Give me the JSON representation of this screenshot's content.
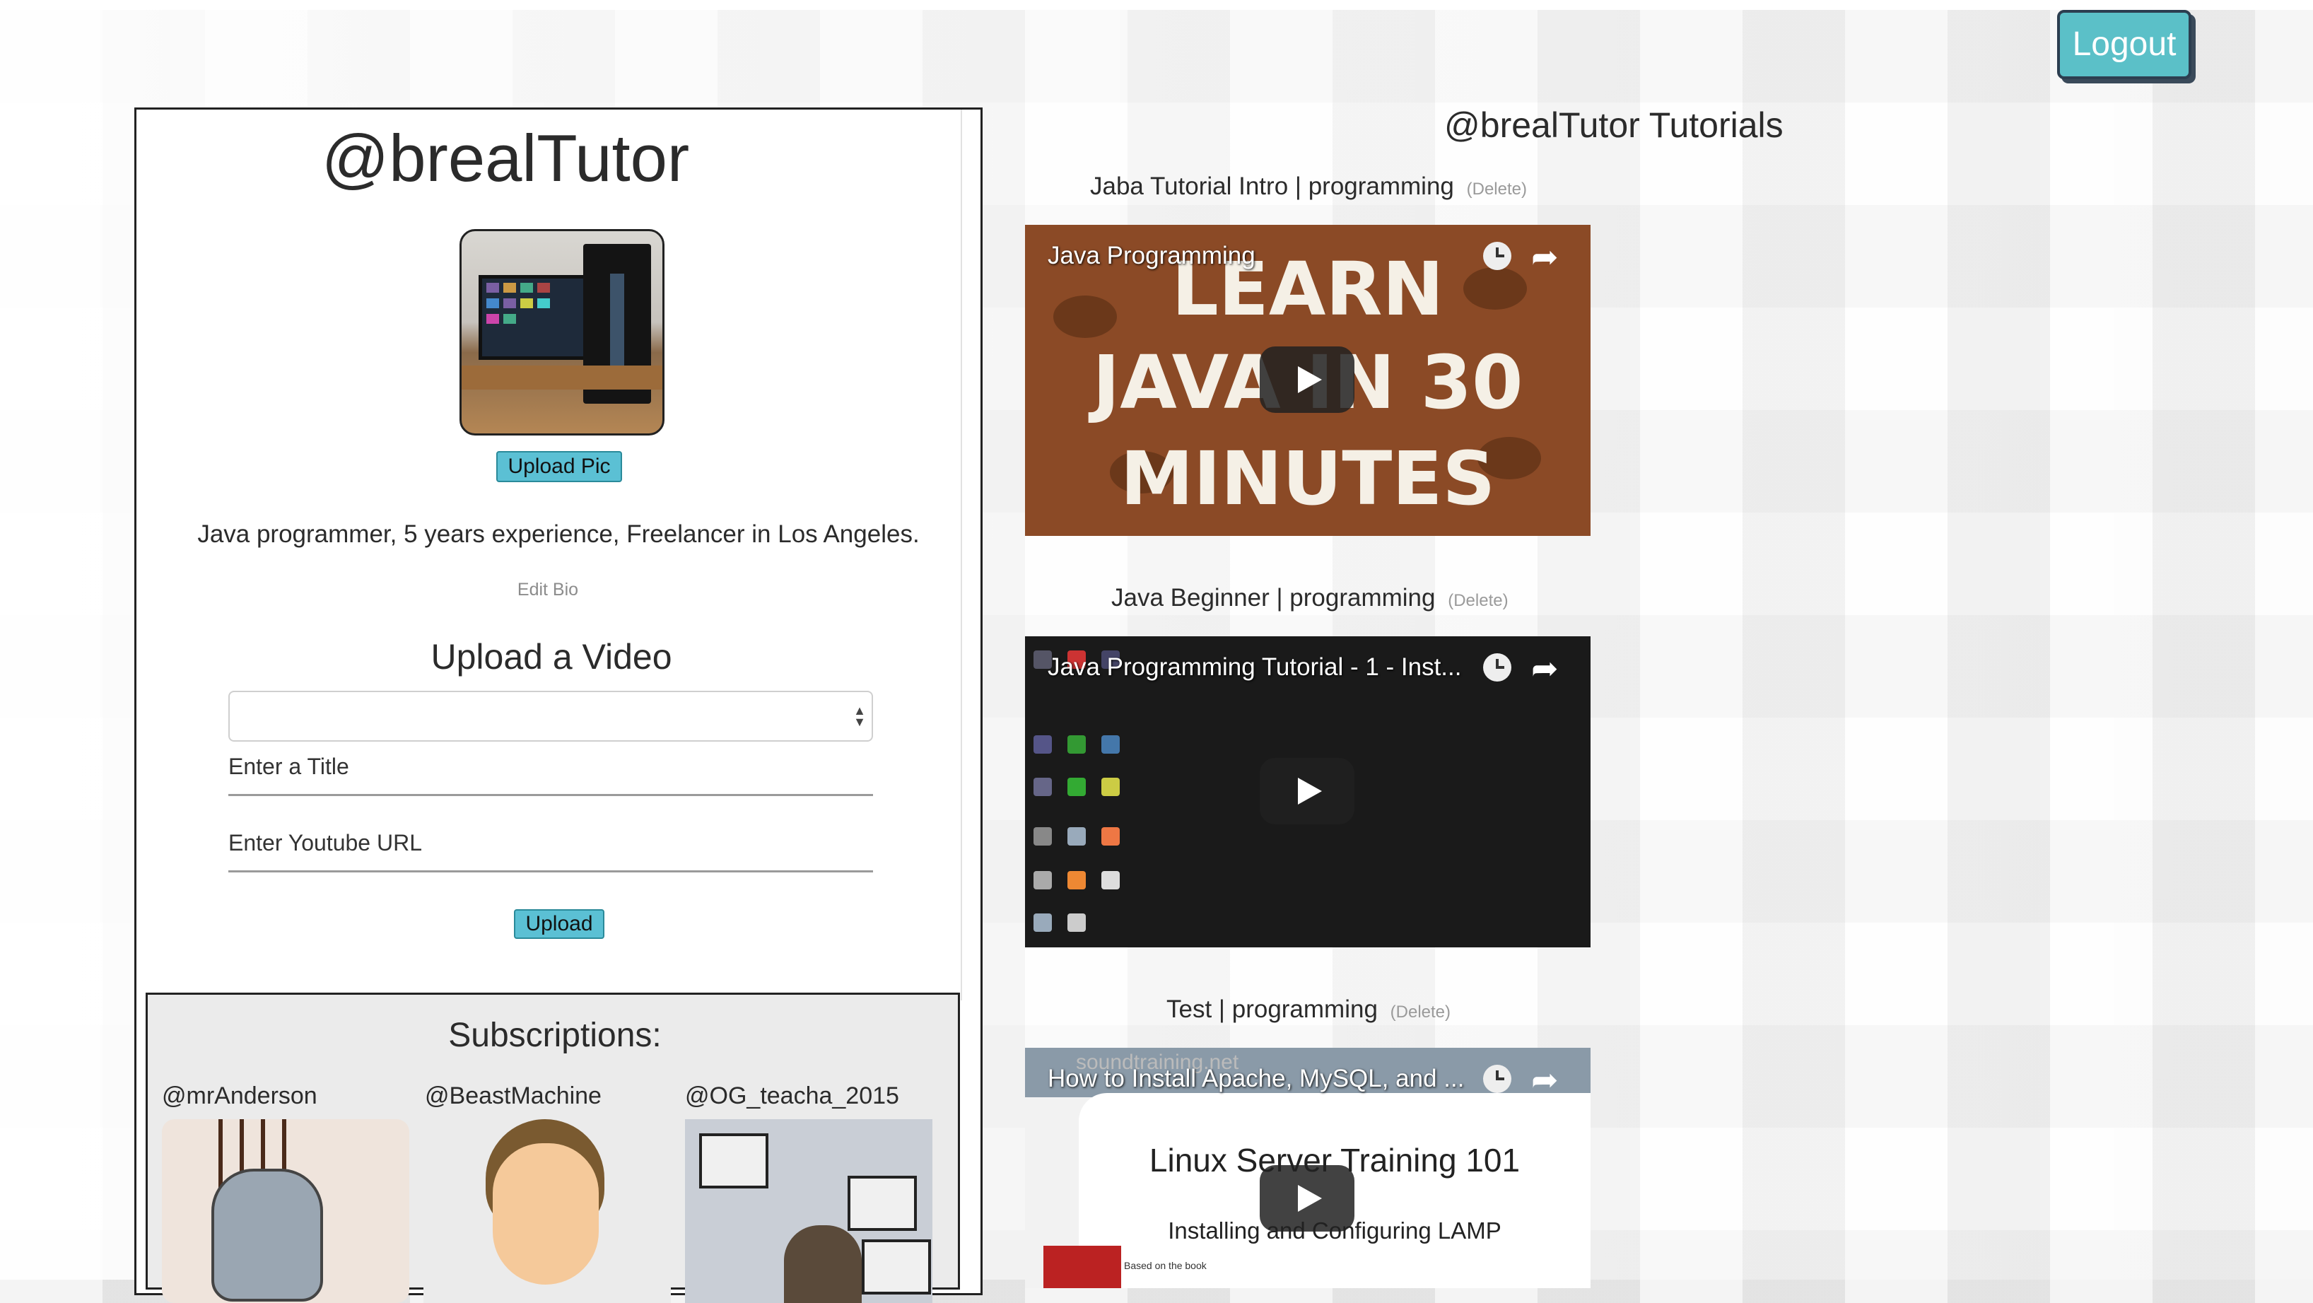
{
  "header": {
    "logout_label": "Logout"
  },
  "profile": {
    "username": "@brealTutor",
    "upload_pic_label": "Upload Pic",
    "bio": "Java programmer, 5 years experience, Freelancer in Los Angeles.",
    "edit_bio_label": "Edit Bio"
  },
  "upload_form": {
    "heading": "Upload a Video",
    "category_value": "",
    "title_placeholder": "Enter a Title",
    "url_placeholder": "Enter Youtube URL",
    "upload_label": "Upload"
  },
  "subscriptions": {
    "heading": "Subscriptions:",
    "items": [
      {
        "name": "@mrAnderson"
      },
      {
        "name": "@BeastMachine"
      },
      {
        "name": "@OG_teacha_2015"
      }
    ]
  },
  "tutorials": {
    "heading": "@brealTutor Tutorials",
    "videos": [
      {
        "title": "Jaba Tutorial Intro | programming",
        "delete_label": "(Delete)",
        "player_title": "Java Programming",
        "thumb_lines": [
          "LEARN",
          "JAVA IN 30",
          "MINUTES"
        ]
      },
      {
        "title": "Java Beginner | programming",
        "delete_label": "(Delete)",
        "player_title": "Java Programming Tutorial - 1 - Inst..."
      },
      {
        "title": "Test | programming",
        "delete_label": "(Delete)",
        "player_title": "How to Install Apache, MySQL, and ...",
        "watermark": "soundtraining.net",
        "thumb_title": "Linux Server Training 101",
        "thumb_subtitle": "Installing and Configuring LAMP",
        "book_caption": "Based on the book"
      }
    ]
  },
  "colors": {
    "accent": "#5bc0d4",
    "logout_bg": "#5bc0c8",
    "panel_border": "#222222"
  },
  "icons": {
    "watch_later": "clock-icon",
    "share": "share-icon",
    "play": "play-icon",
    "select": "select-arrows-icon"
  }
}
